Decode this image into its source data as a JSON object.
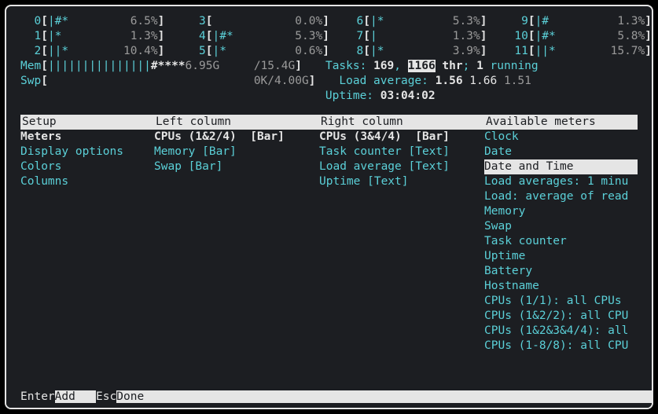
{
  "cpu": [
    {
      "n": "0",
      "bar": "|#*        ",
      "pct": "6.5%"
    },
    {
      "n": "1",
      "bar": "|*         ",
      "pct": "1.3%"
    },
    {
      "n": "2",
      "bar": "||*        ",
      "pct": "10.4%"
    },
    {
      "n": "3",
      "bar": "           ",
      "pct": "0.0%"
    },
    {
      "n": "4",
      "bar": "|#*        ",
      "pct": "5.3%"
    },
    {
      "n": "5",
      "bar": "|*         ",
      "pct": "0.6%"
    },
    {
      "n": "6",
      "bar": "|*         ",
      "pct": "5.3%"
    },
    {
      "n": "7",
      "bar": "|          ",
      "pct": "1.3%"
    },
    {
      "n": "8",
      "bar": "|*         ",
      "pct": "3.9%"
    },
    {
      "n": "9",
      "bar": "|#         ",
      "pct": "1.3%"
    },
    {
      "n": "10",
      "bar": "|#*        ",
      "pct": "5.8%"
    },
    {
      "n": "11",
      "bar": "||*        ",
      "pct": "15.7%"
    }
  ],
  "mem": {
    "label": "Mem",
    "bar": "|||||||||||||||",
    "stars": "#****",
    "used": "6.95G",
    "total": "/15.4G"
  },
  "swp": {
    "label": "Swp",
    "used": "0K",
    "total": "/4.00G"
  },
  "tasks": {
    "label": "Tasks: ",
    "procs": "169",
    "sep": ", ",
    "threads": "1166",
    "thr_label": " thr",
    "sep2": "; ",
    "running": "1",
    "run_label": " running"
  },
  "load": {
    "label": "Load average: ",
    "l1": "1.56",
    "l2": "1.66",
    "l3": "1.51"
  },
  "uptime": {
    "label": "Uptime: ",
    "value": "03:04:02"
  },
  "panels": {
    "setup": {
      "title": "Setup",
      "items": [
        {
          "t": "Meters",
          "sel": "bold"
        },
        {
          "t": "Display options"
        },
        {
          "t": "Colors"
        },
        {
          "t": "Columns"
        }
      ]
    },
    "left": {
      "title": "Left column",
      "items": [
        {
          "t": "CPUs (1&2/4)  [Bar]",
          "sel": "bold"
        },
        {
          "t": "Memory [Bar]"
        },
        {
          "t": "Swap [Bar]"
        }
      ]
    },
    "right": {
      "title": "Right column",
      "items": [
        {
          "t": "CPUs (3&4/4)  [Bar]",
          "sel": "bold"
        },
        {
          "t": "Task counter [Text]"
        },
        {
          "t": "Load average [Text]"
        },
        {
          "t": "Uptime [Text]"
        }
      ]
    },
    "avail": {
      "title": "Available meters",
      "items": [
        {
          "t": "Clock"
        },
        {
          "t": "Date"
        },
        {
          "t": "Date and Time",
          "sel": "inv"
        },
        {
          "t": "Load averages: 1 minu"
        },
        {
          "t": "Load: average of read"
        },
        {
          "t": "Memory"
        },
        {
          "t": "Swap"
        },
        {
          "t": "Task counter"
        },
        {
          "t": "Uptime"
        },
        {
          "t": "Battery"
        },
        {
          "t": "Hostname"
        },
        {
          "t": "CPUs (1/1): all CPUs"
        },
        {
          "t": "CPUs (1&2/2): all CPU"
        },
        {
          "t": "CPUs (1&2&3&4/4): all"
        },
        {
          "t": "CPUs (1-8/8): all CPU"
        }
      ]
    }
  },
  "footer": {
    "k1": "Enter",
    "l1": "Add   ",
    "k2": "Esc",
    "l2": "Done                                                                               "
  }
}
